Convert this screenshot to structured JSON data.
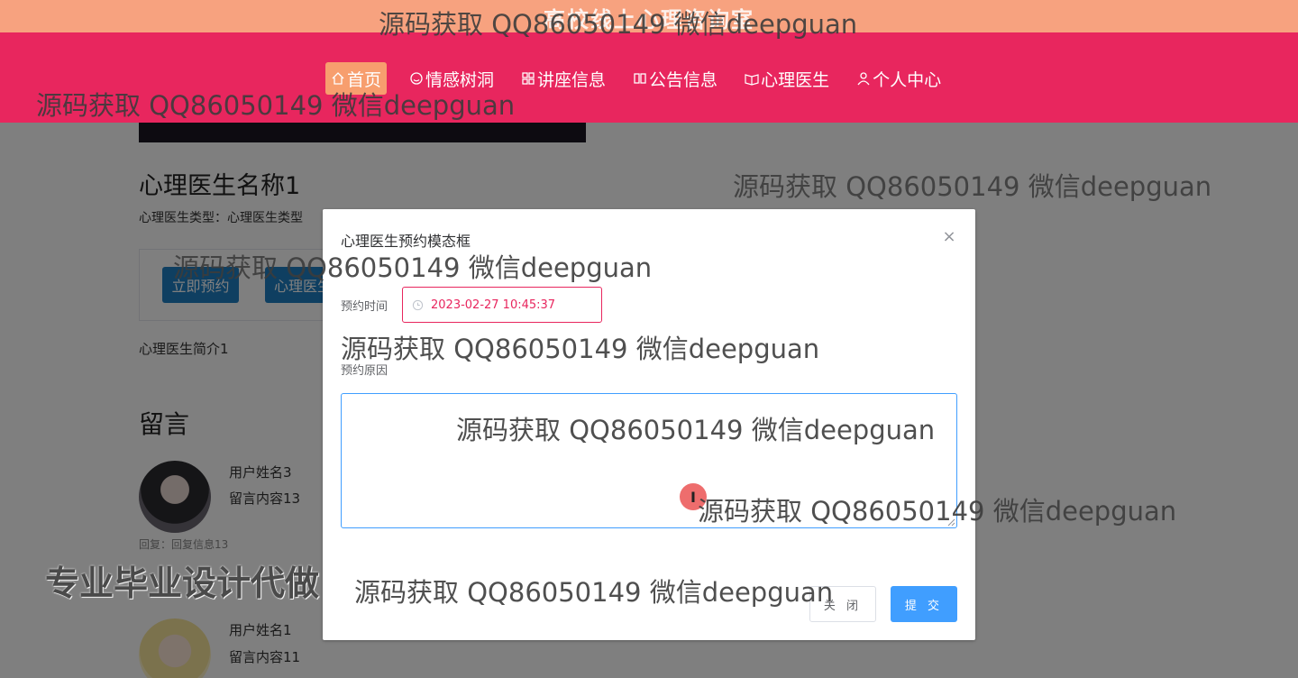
{
  "site": {
    "title": "高校线上心理咨询室"
  },
  "nav": {
    "items": [
      {
        "label": "首页",
        "icon": "home-icon",
        "active": true
      },
      {
        "label": "情感树洞",
        "icon": "smile-icon",
        "active": false
      },
      {
        "label": "讲座信息",
        "icon": "grid-icon",
        "active": false
      },
      {
        "label": "公告信息",
        "icon": "tickets-icon",
        "active": false
      },
      {
        "label": "心理医生",
        "icon": "reading-icon",
        "active": false
      },
      {
        "label": "个人中心",
        "icon": "user-icon",
        "active": false
      }
    ]
  },
  "doctor": {
    "name": "心理医生名称1",
    "type_label": "心理医生类型：",
    "type_value": "心理医生类型",
    "book_button": "立即预约",
    "type_button": "心理医生类型",
    "intro": "心理医生简介1"
  },
  "messages": {
    "title": "留言",
    "items": [
      {
        "user": "用户姓名3",
        "content": "留言内容13",
        "reply": "回复：回复信息13"
      },
      {
        "user": "用户姓名1",
        "content": "留言内容11"
      }
    ]
  },
  "modal": {
    "title": "心理医生预约模态框",
    "close_symbol": "×",
    "time_label": "预约时间",
    "time_value": "2023-02-27 10:45:37",
    "reason_label": "预约原因",
    "reason_value": "",
    "cancel_label": "关 闭",
    "submit_label": "提 交"
  },
  "cursor": {
    "symbol": "I"
  },
  "watermarks": {
    "text": "源码获取 QQ86050149 微信deepguan",
    "badge": "专业毕业设计代做"
  },
  "colors": {
    "nav_bg": "#e8265e",
    "nav_active": "#f79e6e",
    "top_strip": "#f7a27f",
    "primary": "#409eff",
    "doctor_button": "#1f7fc3"
  }
}
